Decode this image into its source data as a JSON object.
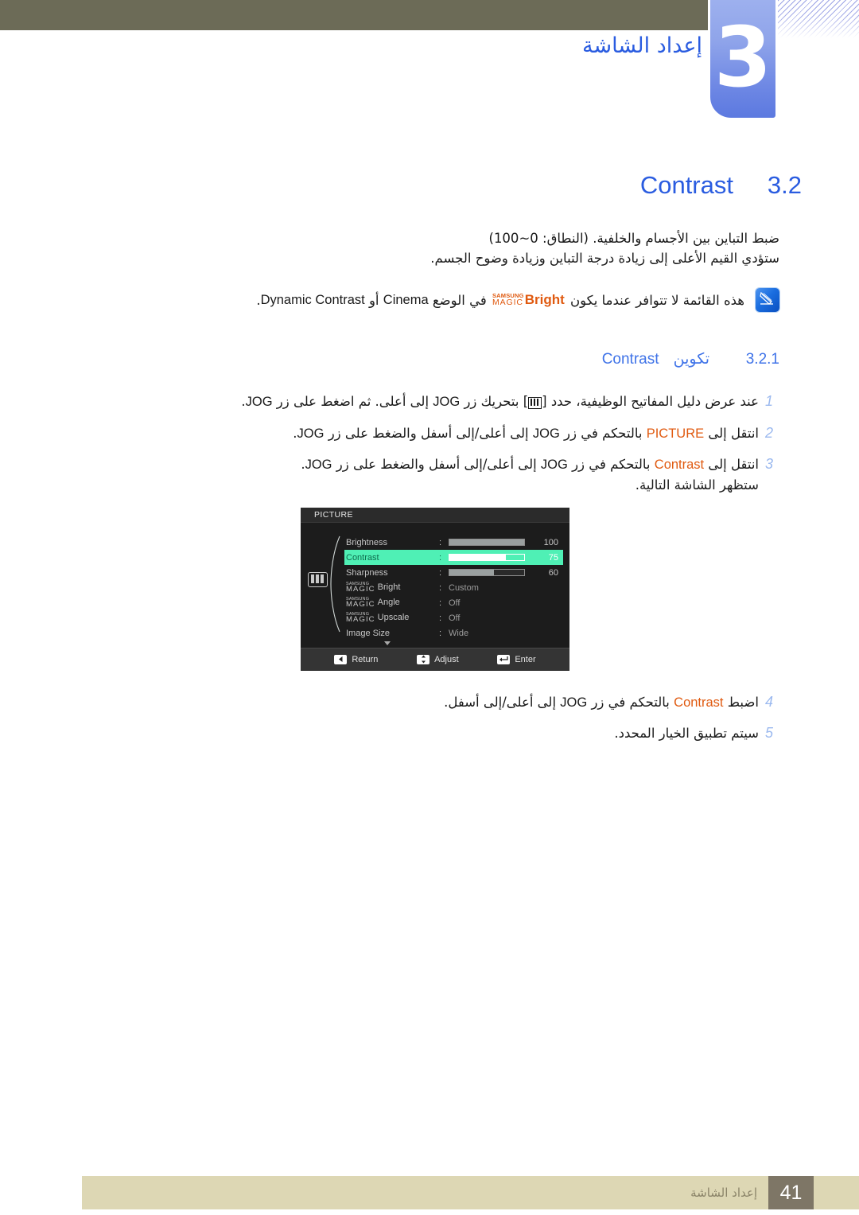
{
  "header": {
    "chapter_number": "3",
    "chapter_title": "إعداد الشاشة"
  },
  "section": {
    "number": "3.2",
    "title": "Contrast",
    "description_line1": "ضبط التباين بين الأجسام والخلفية. (النطاق: 0~100)",
    "description_line2": "ستؤدي القيم الأعلى إلى زيادة درجة التباين وزيادة وضوح الجسم."
  },
  "note": {
    "icon": "note-pen-icon",
    "text_before": "هذه القائمة لا تتوافر عندما يكون",
    "magic_samsung": "SAMSUNG",
    "magic_magic": "MAGIC",
    "magic_word": "Bright",
    "text_middle": "في الوضع",
    "cinema": "Cinema",
    "text_or": "أو",
    "dynamic_contrast": "Dynamic Contrast",
    "text_end": "."
  },
  "subsection": {
    "number": "3.2.1",
    "title_ar": "تكوين",
    "title_lat": "Contrast"
  },
  "steps": [
    {
      "num": "1",
      "lines": [
        {
          "parts": [
            {
              "t": "ar",
              "v": "عند عرض دليل المفاتيح الوظيفية، حدد ["
            },
            {
              "t": "key",
              "v": "function-key-icon"
            },
            {
              "t": "ar",
              "v": "] بتحريك زر "
            },
            {
              "t": "lat",
              "v": "JOG"
            },
            {
              "t": "ar",
              "v": " إلى أعلى. ثم اضغط على زر "
            },
            {
              "t": "lat",
              "v": "JOG"
            },
            {
              "t": "ar",
              "v": "."
            }
          ]
        }
      ]
    },
    {
      "num": "2",
      "lines": [
        {
          "parts": [
            {
              "t": "ar",
              "v": "انتقل إلى "
            },
            {
              "t": "orange",
              "v": "PICTURE"
            },
            {
              "t": "ar",
              "v": " بالتحكم في زر "
            },
            {
              "t": "lat",
              "v": "JOG"
            },
            {
              "t": "ar",
              "v": " إلى أعلى/إلى أسفل والضغط على زر "
            },
            {
              "t": "lat",
              "v": "JOG"
            },
            {
              "t": "ar",
              "v": "."
            }
          ]
        }
      ]
    },
    {
      "num": "3",
      "lines": [
        {
          "parts": [
            {
              "t": "ar",
              "v": "انتقل إلى "
            },
            {
              "t": "orange",
              "v": "Contrast"
            },
            {
              "t": "ar",
              "v": " بالتحكم في زر "
            },
            {
              "t": "lat",
              "v": "JOG"
            },
            {
              "t": "ar",
              "v": " إلى أعلى/إلى أسفل والضغط على زر "
            },
            {
              "t": "lat",
              "v": "JOG"
            },
            {
              "t": "ar",
              "v": "."
            }
          ]
        },
        {
          "parts": [
            {
              "t": "ar",
              "v": "ستظهر الشاشة التالية."
            }
          ]
        }
      ]
    }
  ],
  "steps_after": [
    {
      "num": "4",
      "lines": [
        {
          "parts": [
            {
              "t": "ar",
              "v": "اضبط "
            },
            {
              "t": "orange",
              "v": "Contrast"
            },
            {
              "t": "ar",
              "v": " بالتحكم في زر "
            },
            {
              "t": "lat",
              "v": "JOG"
            },
            {
              "t": "ar",
              "v": " إلى أعلى/إلى أسفل."
            }
          ]
        }
      ]
    },
    {
      "num": "5",
      "lines": [
        {
          "parts": [
            {
              "t": "ar",
              "v": "سيتم تطبيق الخيار المحدد."
            }
          ]
        }
      ]
    }
  ],
  "osd": {
    "title": "PICTURE",
    "side_icon": "picture-bars-icon",
    "rows": [
      {
        "label": "Brightness",
        "kind": "slider",
        "value": "100",
        "percent": 100
      },
      {
        "label": "Contrast",
        "kind": "slider",
        "value": "75",
        "percent": 75,
        "highlight": true
      },
      {
        "label": "Sharpness",
        "kind": "slider",
        "value": "60",
        "percent": 60
      },
      {
        "label": "Bright",
        "kind": "option",
        "value": "Custom",
        "magic": true
      },
      {
        "label": "Angle",
        "kind": "option",
        "value": "Off",
        "magic": true
      },
      {
        "label": "Upscale",
        "kind": "option",
        "value": "Off",
        "magic": true
      },
      {
        "label": "Image Size",
        "kind": "option",
        "value": "Wide",
        "magic": false
      }
    ],
    "magic_samsung": "SAMSUNG",
    "magic_magic": "MAGIC",
    "footer": [
      {
        "icon": "left-arrow-key-icon",
        "label": "Return"
      },
      {
        "icon": "updown-arrow-key-icon",
        "label": "Adjust"
      },
      {
        "icon": "enter-key-icon",
        "label": "Enter"
      }
    ]
  },
  "footer": {
    "chapter_label": "إعداد الشاشة",
    "page_number": "41"
  },
  "colors": {
    "header_bar": "#6c6b57",
    "chapter_tab": "#6d87e4",
    "heading_blue": "#2a5ce0",
    "subheading_blue": "#3f73e8",
    "step_number_blue": "#9bb9ef",
    "accent_orange": "#e05a10",
    "osd_highlight": "#4ff0b5",
    "footer_bar": "#ddd7b4",
    "footer_page_box": "#7e7666"
  }
}
